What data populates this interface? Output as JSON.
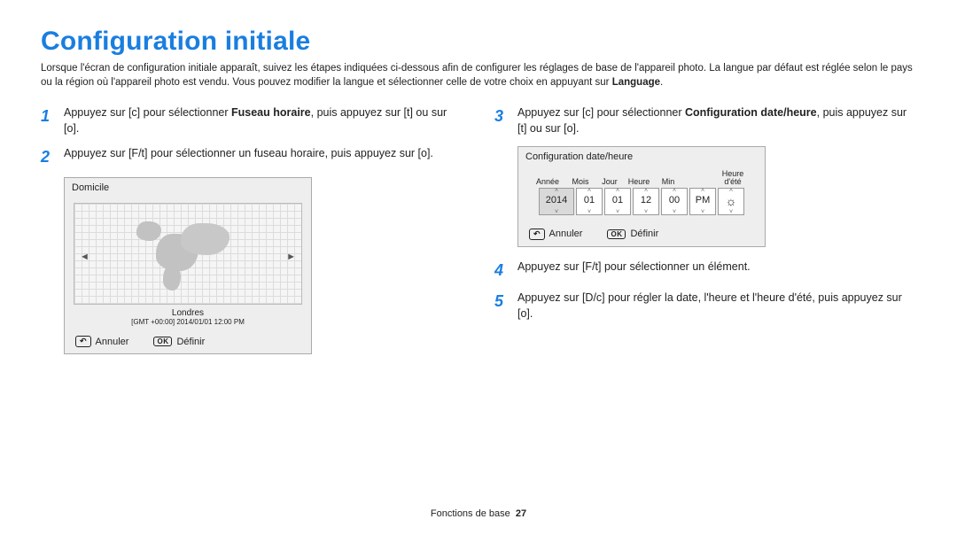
{
  "heading": "Configuration initiale",
  "intro_part1": "Lorsque l'écran de configuration initiale apparaît, suivez les étapes indiquées ci-dessous afin de configurer les réglages de base de l'appareil photo. La langue par défaut est réglée selon le pays ou la région où l'appareil photo est vendu. Vous pouvez modifier la langue et sélectionner celle de votre choix en appuyant sur ",
  "intro_bold": "Language",
  "intro_end": ".",
  "steps": {
    "s1_a": "Appuyez sur [c] pour sélectionner ",
    "s1_bold": "Fuseau horaire",
    "s1_b": ", puis appuyez sur [t] ou sur [o].",
    "s2": "Appuyez sur [F/t] pour sélectionner un fuseau horaire, puis appuyez sur [o].",
    "s3_a": "Appuyez sur [c] pour sélectionner ",
    "s3_bold": "Configuration date/heure",
    "s3_b": ", puis appuyez sur [t] ou sur [o].",
    "s4": "Appuyez sur [F/t] pour sélectionner un élément.",
    "s5": "Appuyez sur [D/c] pour régler la date, l'heure et l'heure d'été, puis appuyez sur [o]."
  },
  "map_ui": {
    "title": "Domicile",
    "city": "Londres",
    "gmt": "[GMT +00:00] 2014/01/01 12:00 PM",
    "cancel": "Annuler",
    "set": "Définir",
    "ok": "OK"
  },
  "dt_ui": {
    "title": "Configuration date/heure",
    "labels": {
      "year": "Année",
      "month": "Mois",
      "day": "Jour",
      "hour": "Heure",
      "min": "Min",
      "dst": "Heure d'été"
    },
    "values": {
      "year": "2014",
      "month": "01",
      "day": "01",
      "hour": "12",
      "min": "00",
      "ampm": "PM"
    },
    "cancel": "Annuler",
    "set": "Définir",
    "ok": "OK"
  },
  "footer": {
    "section": "Fonctions de base",
    "page": "27"
  }
}
